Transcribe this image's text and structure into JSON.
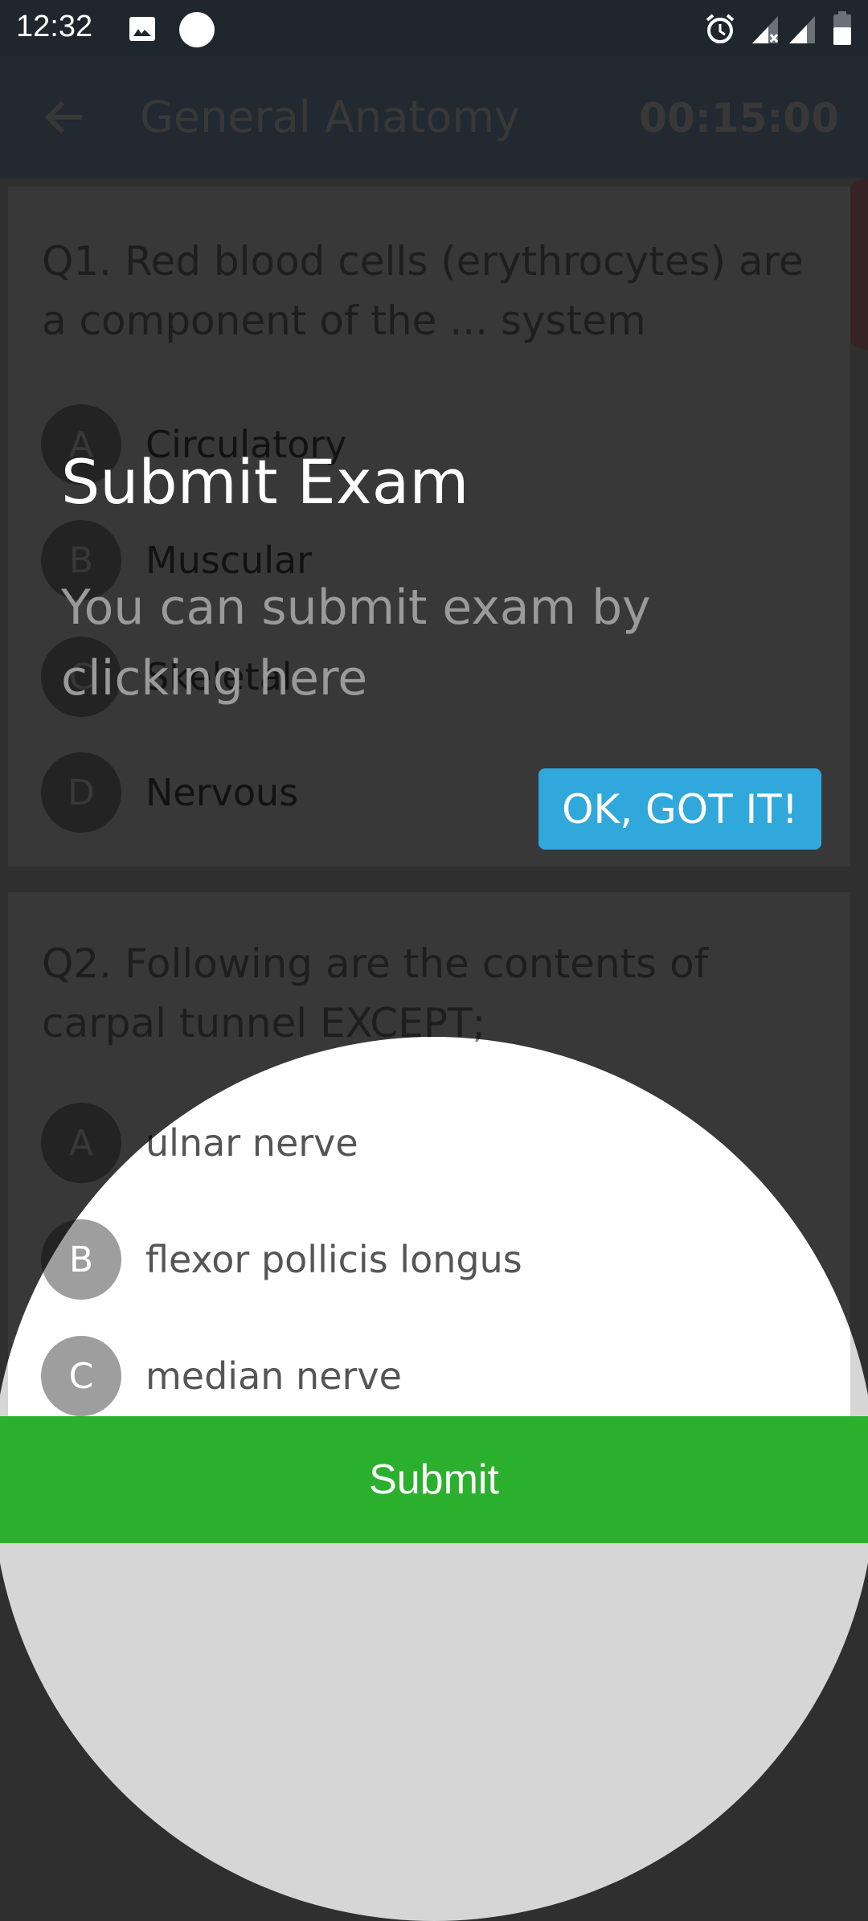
{
  "status_bar": {
    "time": "12:32",
    "icons": [
      "image-icon",
      "circle-icon",
      "alarm-icon",
      "signal-no-sim-icon",
      "signal-icon",
      "battery-icon"
    ]
  },
  "app_bar": {
    "title": "General Anatomy",
    "timer": "00:15:00",
    "back_icon": "arrow-left-icon"
  },
  "questions": [
    {
      "text": "Q1. Red blood cells (erythrocytes) are a component of the ... system",
      "options": [
        {
          "letter": "A",
          "label": "Circulatory"
        },
        {
          "letter": "B",
          "label": "Muscular"
        },
        {
          "letter": "C",
          "label": "Skeletal"
        },
        {
          "letter": "D",
          "label": "Nervous"
        }
      ]
    },
    {
      "text": "Q2. Following are the contents of carpal tunnel EXCEPT;",
      "options": [
        {
          "letter": "A",
          "label": "ulnar nerve"
        },
        {
          "letter": "B",
          "label": "flexor pollicis longus"
        },
        {
          "letter": "C",
          "label": "median nerve"
        }
      ]
    }
  ],
  "tooltip": {
    "title": "Submit Exam",
    "body": "You can submit exam by clicking here",
    "ok_label": "OK, GOT IT!"
  },
  "submit_label": "Submit",
  "colors": {
    "submit": "#2bb02d",
    "ok_button": "#30a8db",
    "status_bar": "#20262e"
  }
}
